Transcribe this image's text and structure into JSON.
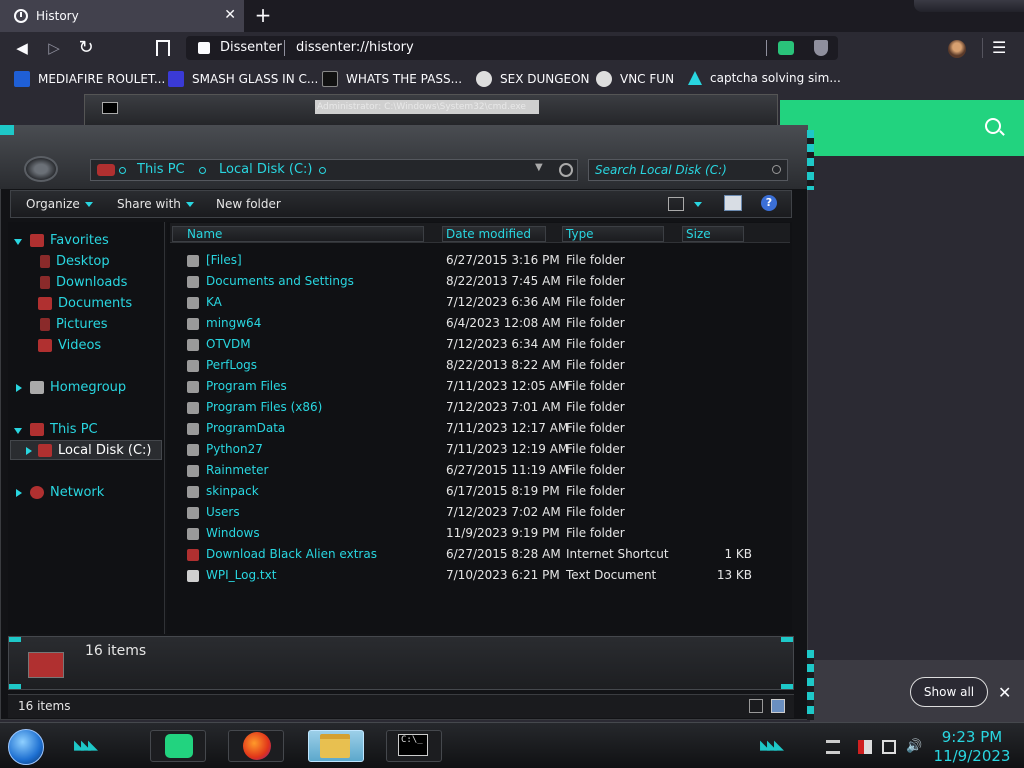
{
  "browser": {
    "tab_title": "History",
    "tab_close": "✕",
    "new_tab": "+",
    "site_name": "Dissenter",
    "url": "dissenter://history",
    "menu": "☰",
    "back": "◀",
    "forward": "▷",
    "reload": "↻",
    "bookmark": "🔖"
  },
  "bookmarks": [
    {
      "label": "MEDIAFIRE ROULET...",
      "color": "#1f5fd6"
    },
    {
      "label": "SMASH GLASS IN C...",
      "color": "#3a3ad6"
    },
    {
      "label": "WHATS THE PASS...",
      "color": "#222222"
    },
    {
      "label": "SEX DUNGEON",
      "color": "#dddddd"
    },
    {
      "label": "VNC FUN",
      "color": "#dddddd"
    },
    {
      "label": "captcha solving sim...",
      "color": "#29d6e0"
    }
  ],
  "cmd": {
    "title": "Administrator: C:\\Windows\\System32\\cmd.exe"
  },
  "explorer": {
    "breadcrumb": [
      "This PC",
      "Local Disk (C:)"
    ],
    "search_placeholder": "Search Local Disk (C:)",
    "toolbar": {
      "organize": "Organize",
      "share_with": "Share with",
      "new_folder": "New folder",
      "help": "?"
    },
    "nav": {
      "favorites": "Favorites",
      "desktop": "Desktop",
      "downloads": "Downloads",
      "documents": "Documents",
      "pictures": "Pictures",
      "videos": "Videos",
      "homegroup": "Homegroup",
      "this_pc": "This PC",
      "local_disk": "Local Disk (C:)",
      "network": "Network"
    },
    "columns": {
      "name": "Name",
      "date_modified": "Date modified",
      "type": "Type",
      "size": "Size"
    },
    "files": [
      {
        "name": "[Files]",
        "date": "6/27/2015 3:16 PM",
        "type": "File folder",
        "size": ""
      },
      {
        "name": "Documents and Settings",
        "date": "8/22/2013 7:45 AM",
        "type": "File folder",
        "size": ""
      },
      {
        "name": "KA",
        "date": "7/12/2023 6:36 AM",
        "type": "File folder",
        "size": ""
      },
      {
        "name": "mingw64",
        "date": "6/4/2023 12:08 AM",
        "type": "File folder",
        "size": ""
      },
      {
        "name": "OTVDM",
        "date": "7/12/2023 6:34 AM",
        "type": "File folder",
        "size": ""
      },
      {
        "name": "PerfLogs",
        "date": "8/22/2013 8:22 AM",
        "type": "File folder",
        "size": ""
      },
      {
        "name": "Program Files",
        "date": "7/11/2023 12:05 AM",
        "type": "File folder",
        "size": ""
      },
      {
        "name": "Program Files (x86)",
        "date": "7/12/2023 7:01 AM",
        "type": "File folder",
        "size": ""
      },
      {
        "name": "ProgramData",
        "date": "7/11/2023 12:17 AM",
        "type": "File folder",
        "size": ""
      },
      {
        "name": "Python27",
        "date": "7/11/2023 12:19 AM",
        "type": "File folder",
        "size": ""
      },
      {
        "name": "Rainmeter",
        "date": "6/27/2015 11:19 AM",
        "type": "File folder",
        "size": ""
      },
      {
        "name": "skinpack",
        "date": "6/17/2015 8:19 PM",
        "type": "File folder",
        "size": ""
      },
      {
        "name": "Users",
        "date": "7/12/2023 7:02 AM",
        "type": "File folder",
        "size": ""
      },
      {
        "name": "Windows",
        "date": "11/9/2023 9:19 PM",
        "type": "File folder",
        "size": ""
      },
      {
        "name": "Download Black Alien extras",
        "date": "6/27/2015 8:28 AM",
        "type": "Internet Shortcut",
        "size": "1 KB"
      },
      {
        "name": "WPI_Log.txt",
        "date": "7/10/2023 6:21 PM",
        "type": "Text Document",
        "size": "13 KB"
      }
    ],
    "details_count": "16 items",
    "status_count": "16 items"
  },
  "downloads_bar": {
    "show_all": "Show all",
    "close": "✕"
  },
  "taskbar": {
    "clock_time": "9:23 PM",
    "clock_date": "11/9/2023",
    "cmd_label": "C:\\_"
  },
  "colors": {
    "accent_teal": "#29d6e0",
    "brand_green": "#22d37f"
  }
}
